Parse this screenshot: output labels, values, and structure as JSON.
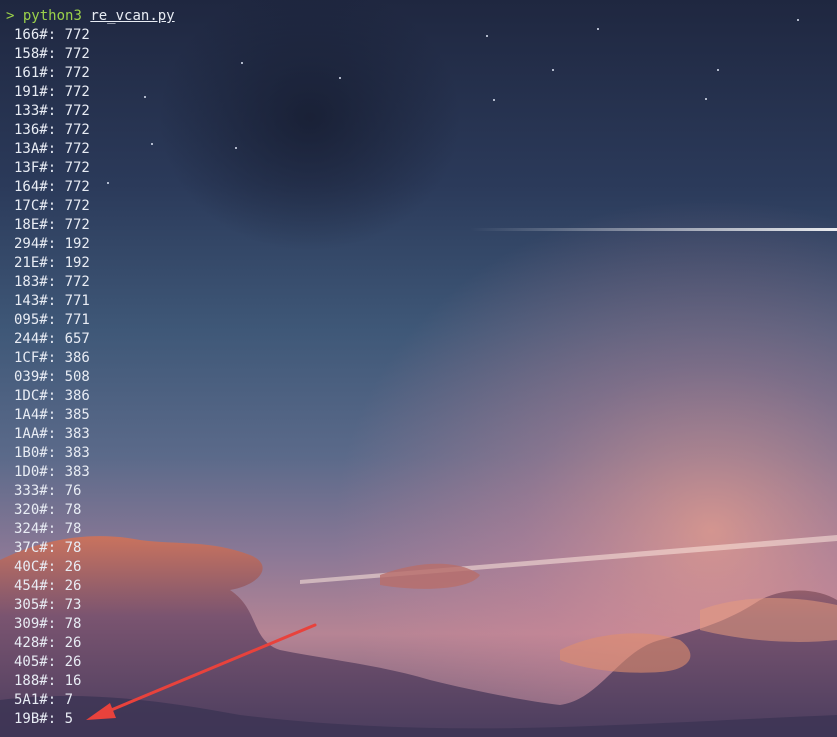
{
  "terminal": {
    "prompt_symbol": ">",
    "command": "python3",
    "script": "re_vcan.py",
    "output": [
      {
        "id": "166#",
        "value": "772"
      },
      {
        "id": "158#",
        "value": "772"
      },
      {
        "id": "161#",
        "value": "772"
      },
      {
        "id": "191#",
        "value": "772"
      },
      {
        "id": "133#",
        "value": "772"
      },
      {
        "id": "136#",
        "value": "772"
      },
      {
        "id": "13A#",
        "value": "772"
      },
      {
        "id": "13F#",
        "value": "772"
      },
      {
        "id": "164#",
        "value": "772"
      },
      {
        "id": "17C#",
        "value": "772"
      },
      {
        "id": "18E#",
        "value": "772"
      },
      {
        "id": "294#",
        "value": "192"
      },
      {
        "id": "21E#",
        "value": "192"
      },
      {
        "id": "183#",
        "value": "772"
      },
      {
        "id": "143#",
        "value": "771"
      },
      {
        "id": "095#",
        "value": "771"
      },
      {
        "id": "244#",
        "value": "657"
      },
      {
        "id": "1CF#",
        "value": "386"
      },
      {
        "id": "039#",
        "value": "508"
      },
      {
        "id": "1DC#",
        "value": "386"
      },
      {
        "id": "1A4#",
        "value": "385"
      },
      {
        "id": "1AA#",
        "value": "383"
      },
      {
        "id": "1B0#",
        "value": "383"
      },
      {
        "id": "1D0#",
        "value": "383"
      },
      {
        "id": "333#",
        "value": "76"
      },
      {
        "id": "320#",
        "value": "78"
      },
      {
        "id": "324#",
        "value": "78"
      },
      {
        "id": "37C#",
        "value": "78"
      },
      {
        "id": "40C#",
        "value": "26"
      },
      {
        "id": "454#",
        "value": "26"
      },
      {
        "id": "305#",
        "value": "73"
      },
      {
        "id": "309#",
        "value": "78"
      },
      {
        "id": "428#",
        "value": "26"
      },
      {
        "id": "405#",
        "value": "26"
      },
      {
        "id": "188#",
        "value": "16"
      },
      {
        "id": "5A1#",
        "value": "7"
      },
      {
        "id": "19B#",
        "value": "5"
      }
    ]
  },
  "colors": {
    "prompt": "#9bd14a",
    "text": "#e8ecf4",
    "annotation_arrow": "#e8423c"
  }
}
